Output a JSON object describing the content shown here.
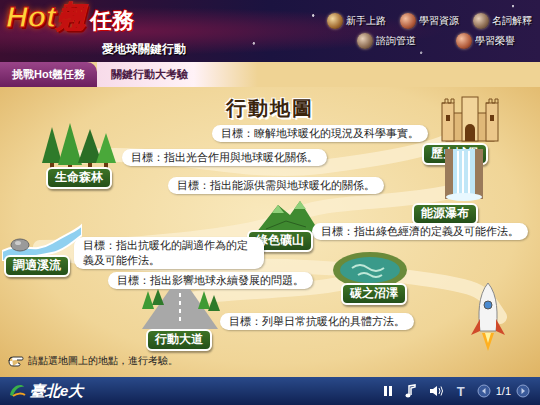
{
  "header": {
    "logo": "Hot翹",
    "title": "任務",
    "subtitle": "愛地球關鍵行動"
  },
  "nav": [
    {
      "label": "新手上路"
    },
    {
      "label": "學習資源"
    },
    {
      "label": "名詞解釋"
    },
    {
      "label": "諮詢管道"
    },
    {
      "label": "學習榮譽"
    }
  ],
  "tabs": [
    {
      "label": "挑戰Hot翹任務",
      "selected": true
    }
  ],
  "section": "關鍵行動大考驗",
  "map": {
    "title": "行動地圖",
    "locations": [
      {
        "name": "歷史城堡",
        "goal": "目標：瞭解地球暖化的現況及科學事實。",
        "kind": "castle"
      },
      {
        "name": "生命森林",
        "goal": "目標：指出光合作用與地球暖化關係。",
        "kind": "forest"
      },
      {
        "name": "能源瀑布",
        "goal": "目標：指出能源供需與地球暖化的關係。",
        "kind": "waterfall"
      },
      {
        "name": "綠色礦山",
        "goal": "目標：指出綠色經濟的定義及可能作法。",
        "kind": "mountain"
      },
      {
        "name": "調適溪流",
        "goal": "目標：指出抗暖化的調適作為的定義及可能作法。",
        "kind": "stream"
      },
      {
        "name": "碳之沼澤",
        "goal": "目標：指出影響地球永續發展的問題。",
        "kind": "swamp"
      },
      {
        "name": "行動大道",
        "goal": "目標：列舉日常抗暖化的具體方法。",
        "kind": "road"
      }
    ],
    "hint": "請點選地圖上的地點，進行考驗。"
  },
  "footer": {
    "logo": "臺北e大",
    "text_button": "T",
    "page": "1/1"
  }
}
